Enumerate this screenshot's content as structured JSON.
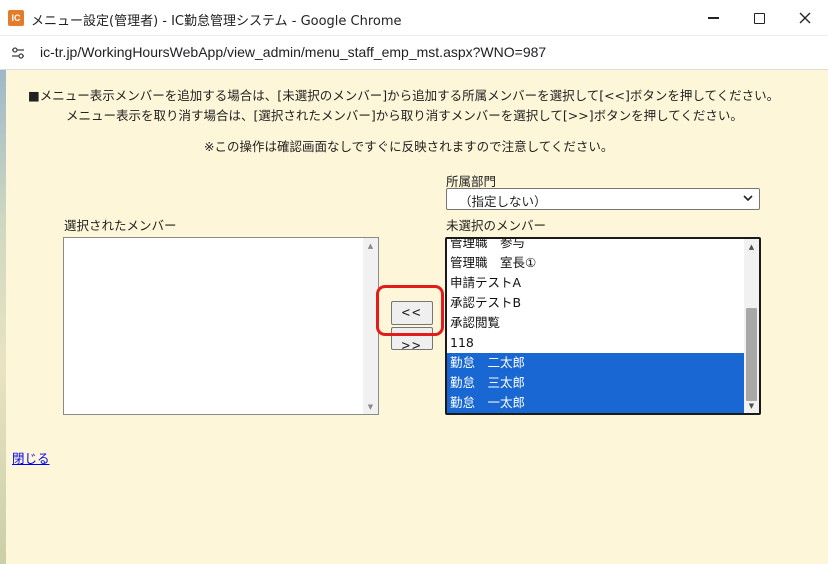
{
  "window": {
    "app_icon_text": "IC",
    "title": "メニュー設定(管理者) - IC勤怠管理システム - Google Chrome",
    "url": "ic-tr.jp/WorkingHoursWebApp/view_admin/menu_staff_emp_mst.aspx?WNO=987"
  },
  "instructions": {
    "line1": "■メニュー表示メンバーを追加する場合は、[未選択のメンバー]から追加する所属メンバーを選択して[<<]ボタンを押してください。",
    "line2": "メニュー表示を取り消す場合は、[選択されたメンバー]から取り消すメンバーを選択して[>>]ボタンを押してください。",
    "note": "※この操作は確認画面なしですぐに反映されますので注意してください。"
  },
  "department": {
    "label": "所属部門",
    "selected": "（指定しない）"
  },
  "selected_members": {
    "label": "選択されたメンバー",
    "items": []
  },
  "unselected_members": {
    "label": "未選択のメンバー",
    "items": [
      {
        "text": "管理職　参与",
        "selected": false
      },
      {
        "text": "管理職　室長①",
        "selected": false
      },
      {
        "text": "申請テストA",
        "selected": false
      },
      {
        "text": "承認テストB",
        "selected": false
      },
      {
        "text": "承認閲覧",
        "selected": false
      },
      {
        "text": "118",
        "selected": false
      },
      {
        "text": "勤怠　二太郎",
        "selected": true
      },
      {
        "text": "勤怠　三太郎",
        "selected": true
      },
      {
        "text": "勤怠　一太郎",
        "selected": true
      }
    ]
  },
  "buttons": {
    "add": "<<",
    "remove": ">>"
  },
  "close_link": "閉じる",
  "colors": {
    "page_bg": "#fdf6d8",
    "selection": "#1967d2",
    "highlight": "#e41b1b",
    "link": "#0000ee"
  }
}
